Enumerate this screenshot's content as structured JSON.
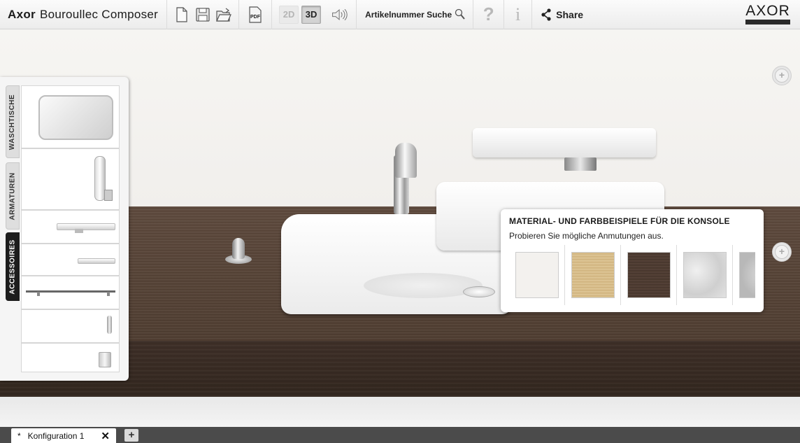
{
  "app": {
    "title_bold": "Axor",
    "title_rest": "Bouroullec Composer"
  },
  "toolbar": {
    "new_icon": "new-document-icon",
    "save_icon": "save-icon",
    "open_icon": "open-folder-icon",
    "pdf_label": "PDF",
    "view_2d": "2D",
    "view_3d": "3D",
    "active_view": "3D",
    "sound_icon": "speaker-icon",
    "search_label": "Artikelnummer Suche",
    "help_label": "?",
    "info_label": "i",
    "share_label": "Share"
  },
  "brand": {
    "logo": "AXOR"
  },
  "panel": {
    "tabs": [
      {
        "label": "WASCHTISCHE",
        "active": false
      },
      {
        "label": "ARMATUREN",
        "active": false
      },
      {
        "label": "ACCESSOIRES",
        "active": true
      }
    ]
  },
  "popup": {
    "title": "MATERIAL- UND FARBBEISPIELE FÜR DIE KONSOLE",
    "subtitle": "Probieren Sie mögliche Anmutungen aus.",
    "swatches": [
      {
        "name": "white",
        "color": "#f3f1ee"
      },
      {
        "name": "light-oak",
        "color": "#d9bf8c"
      },
      {
        "name": "dark-wood",
        "color": "#4f3b30"
      },
      {
        "name": "white-marble",
        "color": "#d7d7d7"
      },
      {
        "name": "grey-marble",
        "color": "#c4c4c4"
      }
    ]
  },
  "tabs": {
    "doc_tab_marker": "*",
    "doc_tab_label": "Konfiguration 1",
    "close_label": "✕",
    "new_tab_label": "+"
  },
  "colors": {
    "counter": "#5a4639",
    "active_tab": "#1d1d1d",
    "tabbar": "#4b4b4b"
  }
}
